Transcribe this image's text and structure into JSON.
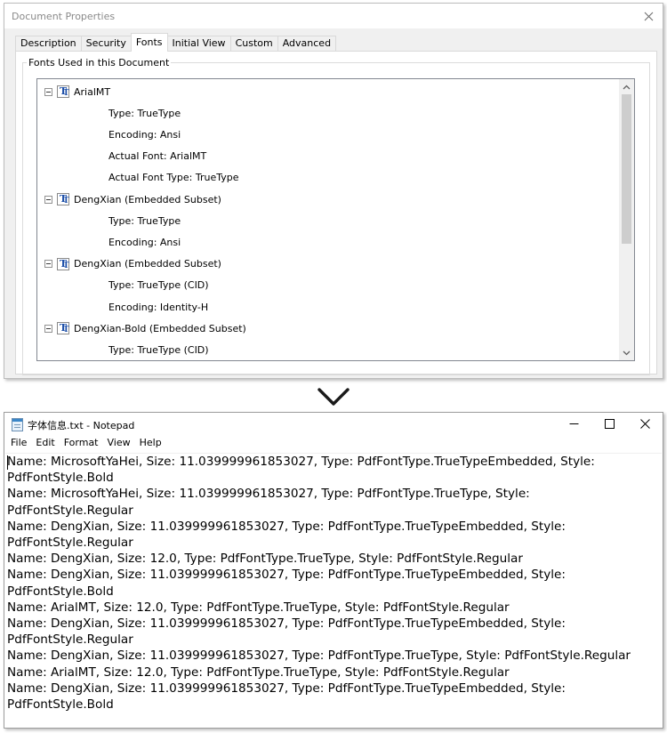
{
  "dialog": {
    "title": "Document Properties",
    "tabs": [
      {
        "label": "Description"
      },
      {
        "label": "Security"
      },
      {
        "label": "Fonts",
        "active": true
      },
      {
        "label": "Initial View"
      },
      {
        "label": "Custom"
      },
      {
        "label": "Advanced"
      }
    ],
    "group_label": "Fonts Used in this Document",
    "tree": [
      {
        "kind": "font",
        "label": "ArialMT"
      },
      {
        "kind": "prop",
        "label": "Type: TrueType"
      },
      {
        "kind": "prop",
        "label": "Encoding: Ansi"
      },
      {
        "kind": "prop",
        "label": "Actual Font: ArialMT"
      },
      {
        "kind": "prop",
        "label": "Actual Font Type: TrueType"
      },
      {
        "kind": "font",
        "label": "DengXian (Embedded Subset)"
      },
      {
        "kind": "prop",
        "label": "Type: TrueType"
      },
      {
        "kind": "prop",
        "label": "Encoding: Ansi"
      },
      {
        "kind": "font",
        "label": "DengXian (Embedded Subset)"
      },
      {
        "kind": "prop",
        "label": "Type: TrueType (CID)"
      },
      {
        "kind": "prop",
        "label": "Encoding: Identity-H"
      },
      {
        "kind": "font",
        "label": "DengXian-Bold (Embedded Subset)"
      },
      {
        "kind": "prop",
        "label": "Type: TrueType (CID)"
      }
    ],
    "scroll_fraction": 0.0
  },
  "notepad": {
    "title": "字体信息.txt - Notepad",
    "menu": [
      {
        "label": "File"
      },
      {
        "label": "Edit"
      },
      {
        "label": "Format"
      },
      {
        "label": "View"
      },
      {
        "label": "Help"
      }
    ],
    "lines": [
      "Name: MicrosoftYaHei, Size: 11.039999961853027, Type: PdfFontType.TrueTypeEmbedded, Style: PdfFontStyle.Bold",
      "Name: MicrosoftYaHei, Size: 11.039999961853027, Type: PdfFontType.TrueType, Style: PdfFontStyle.Regular",
      "Name: DengXian, Size: 11.039999961853027, Type: PdfFontType.TrueTypeEmbedded, Style: PdfFontStyle.Regular",
      "Name: DengXian, Size: 12.0, Type: PdfFontType.TrueType, Style: PdfFontStyle.Regular",
      "Name: DengXian, Size: 11.039999961853027, Type: PdfFontType.TrueTypeEmbedded, Style: PdfFontStyle.Bold",
      "Name: ArialMT, Size: 12.0, Type: PdfFontType.TrueType, Style: PdfFontStyle.Regular",
      "Name: DengXian, Size: 11.039999961853027, Type: PdfFontType.TrueTypeEmbedded, Style: PdfFontStyle.Regular",
      "Name: DengXian, Size: 11.039999961853027, Type: PdfFontType.TrueType, Style: PdfFontStyle.Regular",
      "Name: ArialMT, Size: 12.0, Type: PdfFontType.TrueType, Style: PdfFontStyle.Regular",
      "Name: DengXian, Size: 11.039999961853027, Type: PdfFontType.TrueTypeEmbedded, Style: PdfFontStyle.Bold"
    ]
  },
  "icons": {
    "dialog_close": "close-icon",
    "tree_font": "truetype-font-icon",
    "tree_expander": "collapse-icon",
    "between": "chevron-down-icon",
    "notepad_app": "notepad-icon",
    "minimize": "minimize-icon",
    "maximize": "maximize-icon",
    "close": "close-icon"
  },
  "colors": {
    "dialog_bg": "#f0f0f0",
    "font_icon": "#1d4fa8",
    "scroll_thumb": "#cdcdcd"
  }
}
